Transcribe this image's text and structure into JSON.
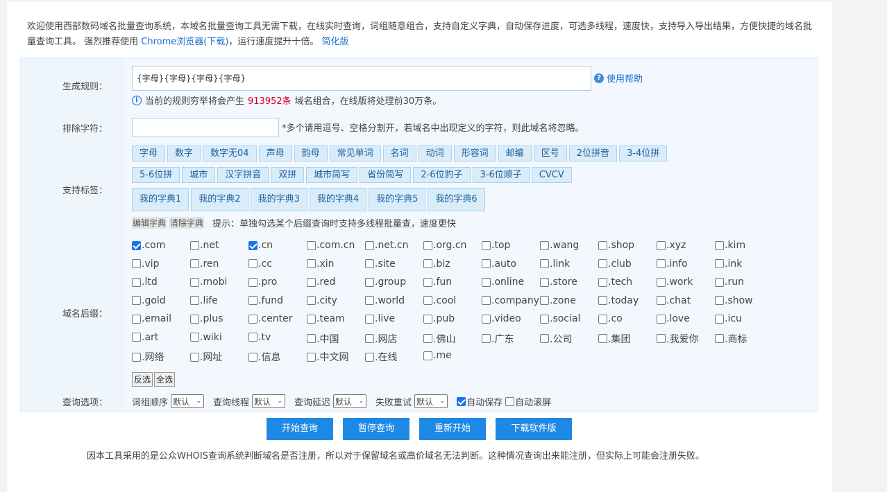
{
  "intro": {
    "text": "欢迎使用西部数码域名批量查询系统，本域名批量查询工具无需下载，在线实时查询，词组随意组合，支持自定义字典，自动保存进度，可选多线程，速度快，支持导入导出结果，方便快捷的域名批量查询工具。 强烈推荐使用 ",
    "browser_link": "Chrome浏览器(下载)",
    "after_link": "，运行速度提升十倍。 ",
    "simple_link": "简化版"
  },
  "form": {
    "rule_label": "生成规则：",
    "rule_value": "{字母}{字母}{字母}{字母}",
    "help_label": "使用帮助",
    "note_prefix": "当前的规则穷举将会产生",
    "note_count": "913952条",
    "note_suffix": "域名组合，在线版将处理前30万条。",
    "exclude_label": "排除字符：",
    "exclude_tip": "*多个请用逗号、空格分割开，若域名中出现定义的字符，则此域名将忽略。",
    "tags_label": "支持标签：",
    "tags_row1": [
      "字母",
      "数字",
      "数字无04",
      "声母",
      "韵母",
      "常见单词",
      "名词",
      "动词",
      "形容词",
      "邮编",
      "区号",
      "2位拼音",
      "3-4位拼"
    ],
    "tags_row2": [
      "5-6位拼",
      "城市",
      "汉字拼音",
      "双拼",
      "城市简写",
      "省份简写",
      "2-6位豹子",
      "3-6位顺子",
      "CVCV"
    ],
    "dict_tags": [
      "我的字典1",
      "我的字典2",
      "我的字典3",
      "我的字典4",
      "我的字典5",
      "我的字典6"
    ],
    "edit_dict": "编辑字典",
    "clear_dict": "清除字典",
    "hint": "提示：单独勾选某个后缀查询时支持多线程批量查，速度更快",
    "suffix_label": "域名后缀：",
    "suffixes": [
      [
        ".com",
        ".net",
        ".cn",
        ".com.cn",
        ".net.cn",
        ".org.cn",
        ".top",
        ".wang",
        ".shop",
        ".xyz",
        ".kim"
      ],
      [
        ".vip",
        ".ren",
        ".cc",
        ".xin",
        ".site",
        ".biz",
        ".auto",
        ".link",
        ".club",
        ".info",
        ".ink"
      ],
      [
        ".ltd",
        ".mobi",
        ".pro",
        ".red",
        ".group",
        ".fun",
        ".online",
        ".store",
        ".tech",
        ".work",
        ".run"
      ],
      [
        ".gold",
        ".life",
        ".fund",
        ".city",
        ".world",
        ".cool",
        ".company",
        ".zone",
        ".today",
        ".chat",
        ".show"
      ],
      [
        ".email",
        ".plus",
        ".center",
        ".team",
        ".live",
        ".pub",
        ".video",
        ".social",
        ".co",
        ".love",
        ".icu"
      ],
      [
        ".art",
        ".wiki",
        ".tv",
        ".中国",
        ".网店",
        ".佛山",
        ".广东",
        ".公司",
        ".集团",
        ".我爱你",
        ".商标"
      ],
      [
        ".网络",
        ".网址",
        ".信息",
        ".中文网",
        ".在线",
        ".me"
      ]
    ],
    "checked_suffixes": [
      ".com",
      ".cn"
    ],
    "invert_btn": "反选",
    "all_btn": "全选",
    "options_label": "查询选项：",
    "options": [
      {
        "label": "词组顺序",
        "value": "默认"
      },
      {
        "label": "查询线程",
        "value": "默认"
      },
      {
        "label": "查询延迟",
        "value": "默认"
      },
      {
        "label": "失败重试",
        "value": "默认"
      }
    ],
    "auto_save": "自动保存",
    "auto_save_checked": true,
    "auto_scroll": "自动滚屏",
    "auto_scroll_checked": false
  },
  "actions": [
    "开始查询",
    "暂停查询",
    "重新开始",
    "下载软件版"
  ],
  "footer": "因本工具采用的是公众WHOIS查询系统判断域名是否注册，所以对于保留域名或高价域名无法判断。这种情况查询出来能注册，但实际上可能会注册失败。",
  "colors": {
    "accent": "#1e88e5",
    "link": "#1a6fd1",
    "warning": "#d9001b",
    "tag_bg": "#d9ecfa"
  }
}
